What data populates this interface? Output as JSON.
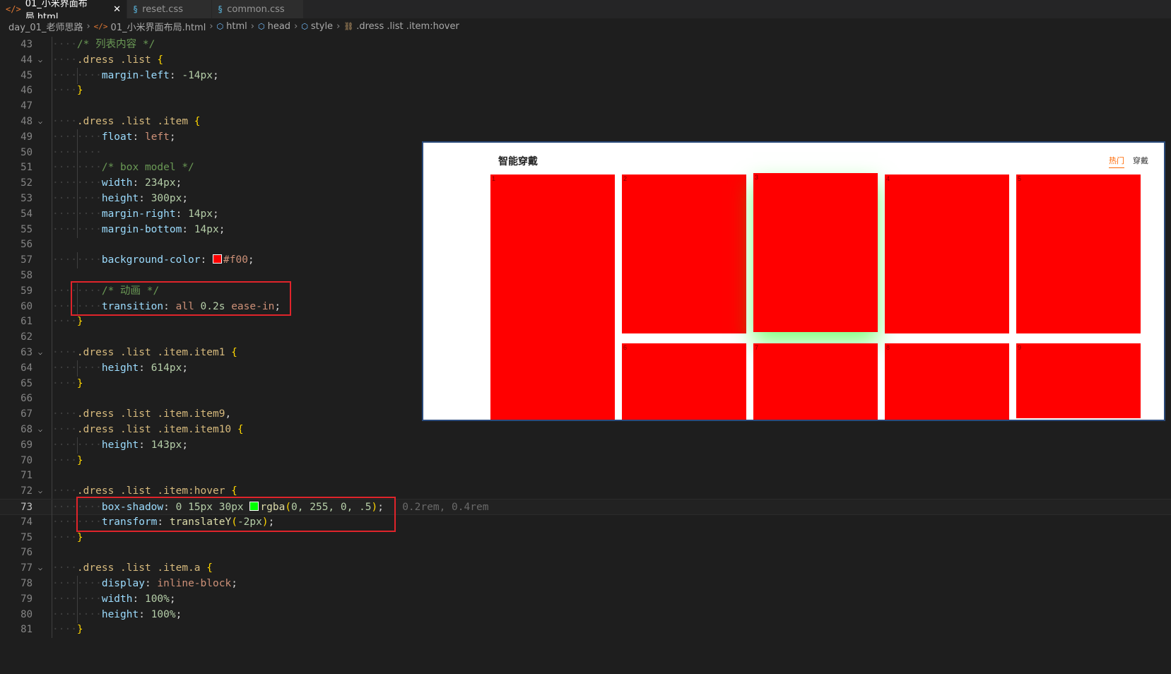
{
  "tabs": [
    {
      "label": "01_小米界面布局.html",
      "icon": "html-file-icon",
      "active": true
    },
    {
      "label": "reset.css",
      "icon": "css-file-icon",
      "active": false
    },
    {
      "label": "common.css",
      "icon": "css-file-icon",
      "active": false
    }
  ],
  "breadcrumb": [
    "day_01_老师思路",
    "01_小米界面布局.html",
    "html",
    "head",
    "style",
    ".dress .list .item:hover"
  ],
  "lines": [
    {
      "n": "43",
      "indent": 1,
      "segs": [
        [
          "/* 列表内容 */",
          "cm"
        ]
      ]
    },
    {
      "n": "44",
      "indent": 1,
      "fold": true,
      "segs": [
        [
          ".dress .list ",
          "sel"
        ],
        [
          "{",
          "br"
        ]
      ]
    },
    {
      "n": "45",
      "indent": 2,
      "segs": [
        [
          "margin-left",
          "prop"
        ],
        [
          ": ",
          "pu"
        ],
        [
          "-14px",
          "num"
        ],
        [
          ";",
          "pu"
        ]
      ]
    },
    {
      "n": "46",
      "indent": 1,
      "segs": [
        [
          "}",
          "br"
        ]
      ]
    },
    {
      "n": "47",
      "indent": 0,
      "segs": []
    },
    {
      "n": "48",
      "indent": 1,
      "fold": true,
      "segs": [
        [
          ".dress .list .item ",
          "sel"
        ],
        [
          "{",
          "br"
        ]
      ]
    },
    {
      "n": "49",
      "indent": 2,
      "segs": [
        [
          "float",
          "prop"
        ],
        [
          ": ",
          "pu"
        ],
        [
          "left",
          "kw"
        ],
        [
          ";",
          "pu"
        ]
      ]
    },
    {
      "n": "50",
      "indent": 2,
      "segs": []
    },
    {
      "n": "51",
      "indent": 2,
      "segs": [
        [
          "/* box model */",
          "cm"
        ]
      ]
    },
    {
      "n": "52",
      "indent": 2,
      "segs": [
        [
          "width",
          "prop"
        ],
        [
          ": ",
          "pu"
        ],
        [
          "234px",
          "num"
        ],
        [
          ";",
          "pu"
        ]
      ]
    },
    {
      "n": "53",
      "indent": 2,
      "segs": [
        [
          "height",
          "prop"
        ],
        [
          ": ",
          "pu"
        ],
        [
          "300px",
          "num"
        ],
        [
          ";",
          "pu"
        ]
      ]
    },
    {
      "n": "54",
      "indent": 2,
      "segs": [
        [
          "margin-right",
          "prop"
        ],
        [
          ": ",
          "pu"
        ],
        [
          "14px",
          "num"
        ],
        [
          ";",
          "pu"
        ]
      ]
    },
    {
      "n": "55",
      "indent": 2,
      "segs": [
        [
          "margin-bottom",
          "prop"
        ],
        [
          ": ",
          "pu"
        ],
        [
          "14px",
          "num"
        ],
        [
          ";",
          "pu"
        ]
      ]
    },
    {
      "n": "56",
      "indent": 0,
      "segs": []
    },
    {
      "n": "57",
      "indent": 2,
      "segs": [
        [
          "background-color",
          "prop"
        ],
        [
          ": ",
          "pu"
        ],
        [
          "#ff0000",
          "swatch"
        ],
        [
          "#f00",
          "kw"
        ],
        [
          ";",
          "pu"
        ]
      ]
    },
    {
      "n": "58",
      "indent": 0,
      "segs": []
    },
    {
      "n": "59",
      "indent": 2,
      "segs": [
        [
          "/* 动画 */",
          "cm"
        ]
      ]
    },
    {
      "n": "60",
      "indent": 2,
      "segs": [
        [
          "transition",
          "prop"
        ],
        [
          ": ",
          "pu"
        ],
        [
          "all ",
          "kw"
        ],
        [
          "0.2s ",
          "num"
        ],
        [
          "ease-in",
          "kw"
        ],
        [
          ";",
          "pu"
        ]
      ]
    },
    {
      "n": "61",
      "indent": 1,
      "segs": [
        [
          "}",
          "br"
        ]
      ]
    },
    {
      "n": "62",
      "indent": 0,
      "segs": []
    },
    {
      "n": "63",
      "indent": 1,
      "fold": true,
      "segs": [
        [
          ".dress .list .item.item1 ",
          "sel"
        ],
        [
          "{",
          "br"
        ]
      ]
    },
    {
      "n": "64",
      "indent": 2,
      "segs": [
        [
          "height",
          "prop"
        ],
        [
          ": ",
          "pu"
        ],
        [
          "614px",
          "num"
        ],
        [
          ";",
          "pu"
        ]
      ]
    },
    {
      "n": "65",
      "indent": 1,
      "segs": [
        [
          "}",
          "br"
        ]
      ]
    },
    {
      "n": "66",
      "indent": 0,
      "segs": []
    },
    {
      "n": "67",
      "indent": 1,
      "segs": [
        [
          ".dress .list .item.item9",
          "sel"
        ],
        [
          ",",
          "pu"
        ]
      ]
    },
    {
      "n": "68",
      "indent": 1,
      "fold": true,
      "segs": [
        [
          ".dress .list .item.item10 ",
          "sel"
        ],
        [
          "{",
          "br"
        ]
      ]
    },
    {
      "n": "69",
      "indent": 2,
      "segs": [
        [
          "height",
          "prop"
        ],
        [
          ": ",
          "pu"
        ],
        [
          "143px",
          "num"
        ],
        [
          ";",
          "pu"
        ]
      ]
    },
    {
      "n": "70",
      "indent": 1,
      "segs": [
        [
          "}",
          "br"
        ]
      ]
    },
    {
      "n": "71",
      "indent": 0,
      "segs": []
    },
    {
      "n": "72",
      "indent": 1,
      "fold": true,
      "segs": [
        [
          ".dress .list .item:hover ",
          "sel"
        ],
        [
          "{",
          "br"
        ]
      ]
    },
    {
      "n": "73",
      "indent": 2,
      "current": true,
      "segs": [
        [
          "box-shadow",
          "prop"
        ],
        [
          ": ",
          "pu"
        ],
        [
          "0 15px 30px ",
          "num"
        ],
        [
          "#00ff00",
          "swatch"
        ],
        [
          "rgba",
          "fn"
        ],
        [
          "(",
          "br"
        ],
        [
          "0, 255, 0, .5",
          "num"
        ],
        [
          ")",
          "br"
        ],
        [
          ";",
          "pu"
        ],
        [
          "   0.2rem, 0.4rem",
          "ghost"
        ]
      ]
    },
    {
      "n": "74",
      "indent": 2,
      "segs": [
        [
          "transform",
          "prop"
        ],
        [
          ": ",
          "pu"
        ],
        [
          "translateY",
          "fn"
        ],
        [
          "(",
          "br"
        ],
        [
          "-2px",
          "num"
        ],
        [
          ")",
          "br"
        ],
        [
          ";",
          "pu"
        ]
      ]
    },
    {
      "n": "75",
      "indent": 1,
      "segs": [
        [
          "}",
          "br"
        ]
      ]
    },
    {
      "n": "76",
      "indent": 0,
      "segs": []
    },
    {
      "n": "77",
      "indent": 1,
      "fold": true,
      "segs": [
        [
          ".dress .list .item.a ",
          "sel"
        ],
        [
          "{",
          "br"
        ]
      ]
    },
    {
      "n": "78",
      "indent": 2,
      "segs": [
        [
          "display",
          "prop"
        ],
        [
          ": ",
          "pu"
        ],
        [
          "inline-block",
          "kw"
        ],
        [
          ";",
          "pu"
        ]
      ]
    },
    {
      "n": "79",
      "indent": 2,
      "segs": [
        [
          "width",
          "prop"
        ],
        [
          ": ",
          "pu"
        ],
        [
          "100%",
          "num"
        ],
        [
          ";",
          "pu"
        ]
      ]
    },
    {
      "n": "80",
      "indent": 2,
      "segs": [
        [
          "height",
          "prop"
        ],
        [
          ": ",
          "pu"
        ],
        [
          "100%",
          "num"
        ],
        [
          ";",
          "pu"
        ]
      ]
    },
    {
      "n": "81",
      "indent": 1,
      "segs": [
        [
          "}",
          "br"
        ]
      ]
    }
  ],
  "preview": {
    "title": "智能穿戴",
    "tabs": [
      {
        "label": "热门",
        "active": true
      },
      {
        "label": "穿戴",
        "active": false
      }
    ],
    "items": [
      "1",
      "2",
      "3",
      "4",
      "5",
      "6",
      "7",
      "8",
      "9"
    ],
    "hover_item": "3",
    "item_color": "#ff0000",
    "shadow_color": "rgba(0,255,0,.5)"
  }
}
